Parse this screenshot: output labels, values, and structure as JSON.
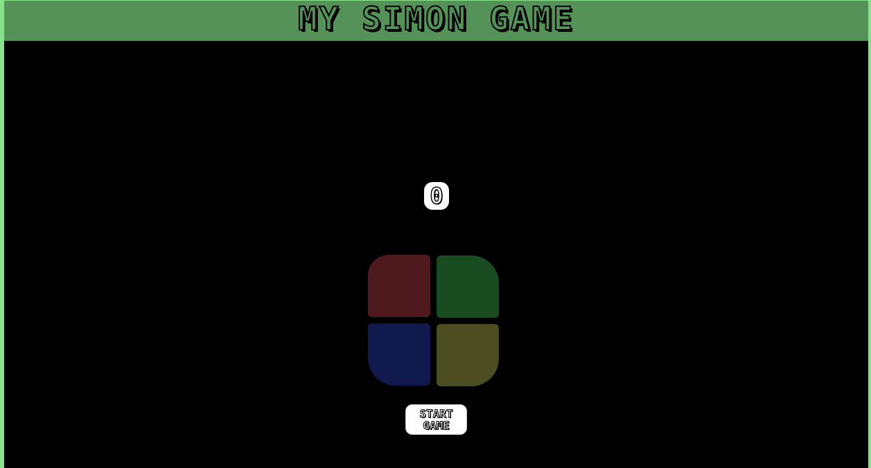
{
  "header": {
    "title": "My Simon Game"
  },
  "game": {
    "score": "0",
    "start_label": "Start\nGame",
    "pads": [
      {
        "id": "red",
        "color": "#4f1a1e"
      },
      {
        "id": "green",
        "color": "#184b20"
      },
      {
        "id": "blue",
        "color": "#111a4c"
      },
      {
        "id": "yellow",
        "color": "#4d4d22"
      }
    ]
  },
  "colors": {
    "page_background": "#86e38a",
    "header_background": "#559257",
    "stage_background": "#000000"
  }
}
